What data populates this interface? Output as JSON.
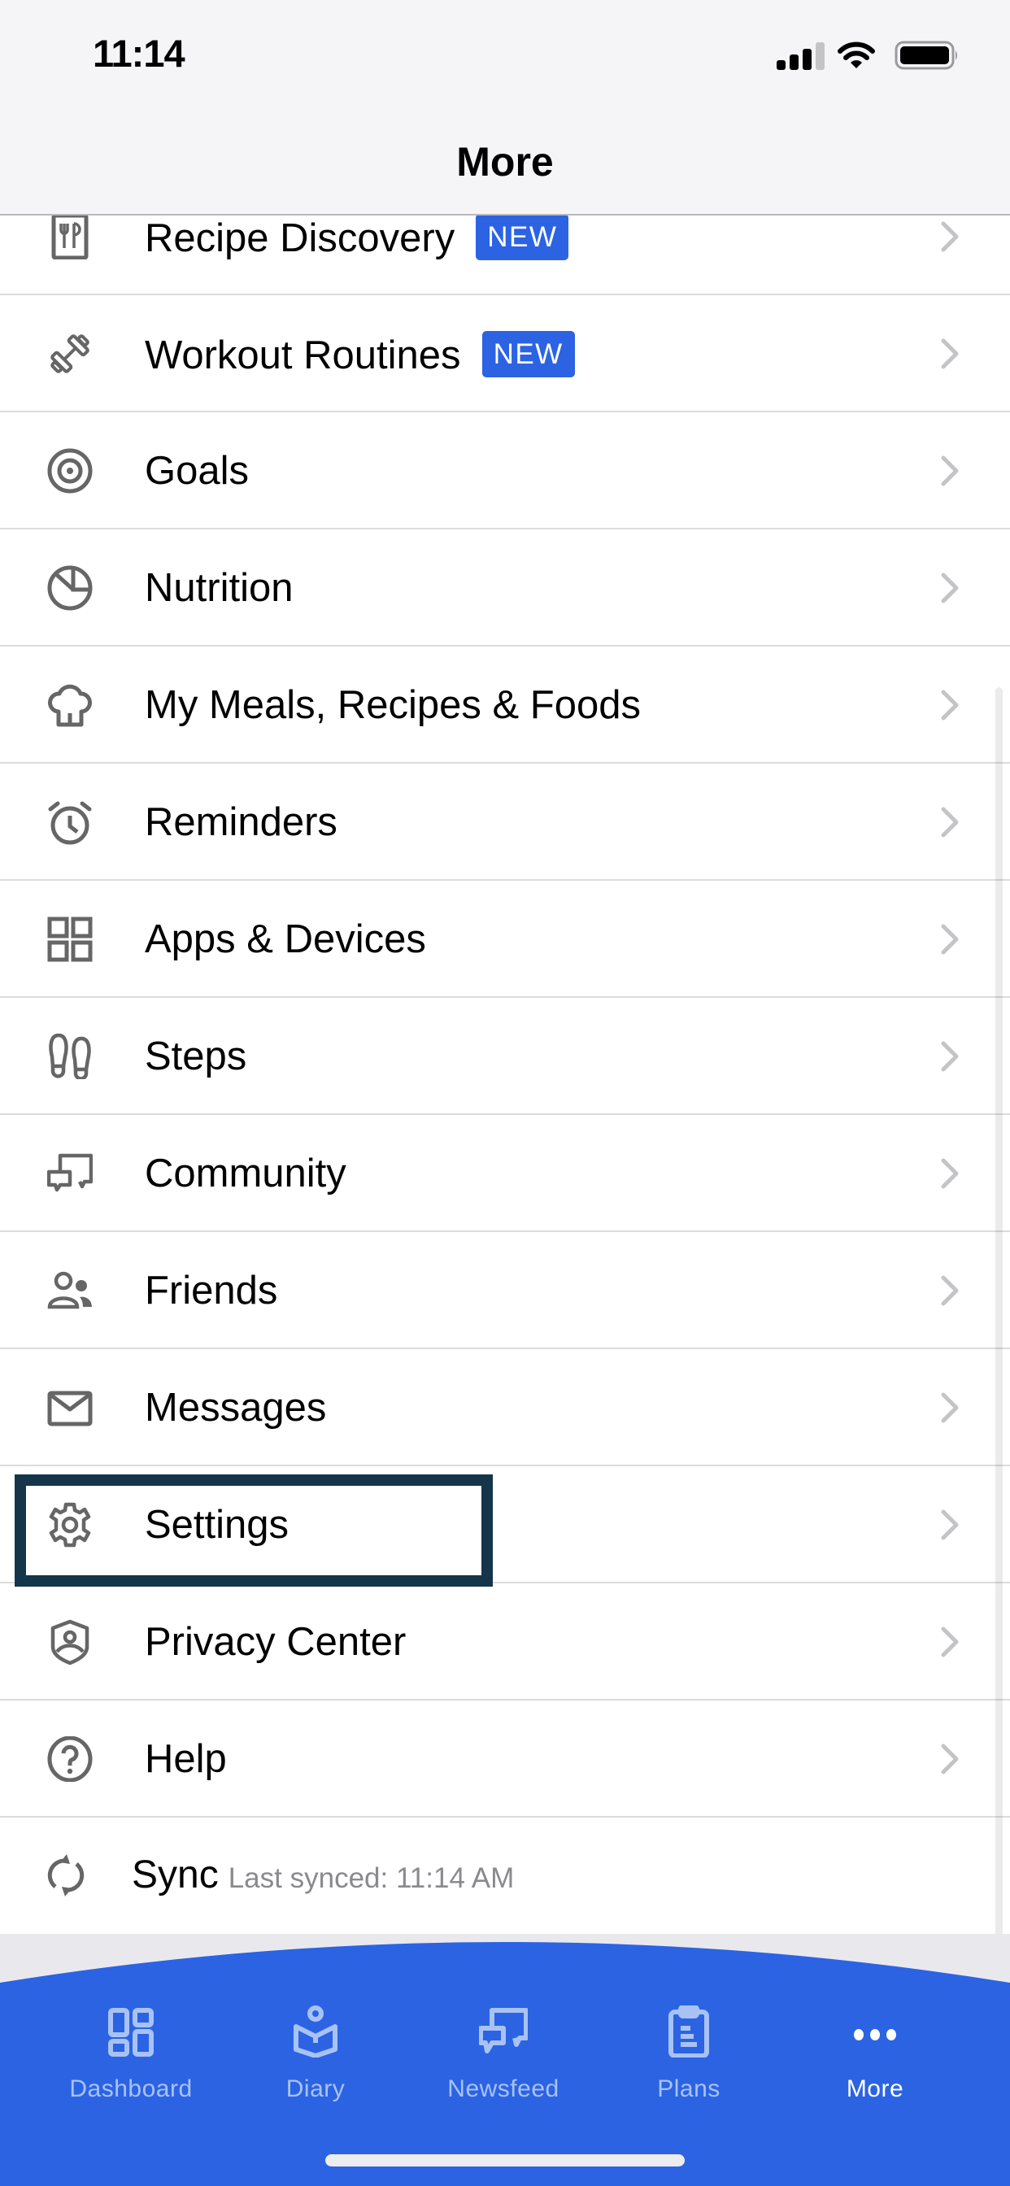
{
  "status_bar": {
    "time": "11:14",
    "signal_bars_active": 3,
    "signal_bars_total": 4,
    "wifi": "wifi-icon",
    "battery": "battery-full-icon"
  },
  "header": {
    "title": "More"
  },
  "menu": {
    "items": [
      {
        "label": "Recipe Discovery",
        "badge": "NEW",
        "icon": "recipe-icon"
      },
      {
        "label": "Workout Routines",
        "badge": "NEW",
        "icon": "dumbbell-icon"
      },
      {
        "label": "Goals",
        "icon": "target-icon"
      },
      {
        "label": "Nutrition",
        "icon": "pie-chart-icon"
      },
      {
        "label": "My Meals, Recipes & Foods",
        "icon": "chef-hat-icon"
      },
      {
        "label": "Reminders",
        "icon": "alarm-clock-icon"
      },
      {
        "label": "Apps & Devices",
        "icon": "grid-icon"
      },
      {
        "label": "Steps",
        "icon": "footprints-icon"
      },
      {
        "label": "Community",
        "icon": "chat-bubbles-icon"
      },
      {
        "label": "Friends",
        "icon": "people-icon"
      },
      {
        "label": "Messages",
        "icon": "envelope-icon"
      },
      {
        "label": "Settings",
        "icon": "gear-icon",
        "highlighted": true
      },
      {
        "label": "Privacy Center",
        "icon": "shield-user-icon"
      },
      {
        "label": "Help",
        "icon": "help-circle-icon"
      }
    ],
    "sync": {
      "label": "Sync",
      "status": "Last synced: 11:14 AM",
      "icon": "sync-icon"
    }
  },
  "tab_bar": {
    "tabs": [
      {
        "label": "Dashboard",
        "icon": "dashboard-icon",
        "active": false
      },
      {
        "label": "Diary",
        "icon": "diary-icon",
        "active": false
      },
      {
        "label": "Newsfeed",
        "icon": "newsfeed-icon",
        "active": false
      },
      {
        "label": "Plans",
        "icon": "clipboard-icon",
        "active": false
      },
      {
        "label": "More",
        "icon": "more-dots-icon",
        "active": true
      }
    ]
  },
  "colors": {
    "brand_blue": "#2b63e3",
    "highlight_border": "#15354a",
    "icon_gray": "#666666",
    "tab_inactive": "#a8c2f4"
  }
}
